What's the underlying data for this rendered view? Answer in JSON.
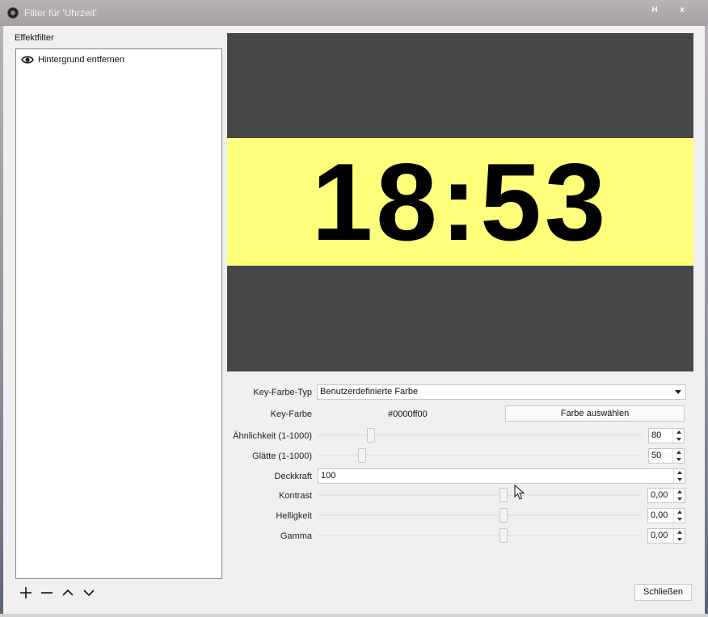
{
  "window": {
    "title": "Filter für 'Uhrzeit'",
    "help_label": "H",
    "close_label": "x"
  },
  "filters": {
    "section_label": "Effektfilter",
    "items": [
      {
        "name": "Hintergrund entfernen",
        "visible": true
      }
    ]
  },
  "preview": {
    "clock": "18:53",
    "background_color": "#474747",
    "band_color": "#feff7a"
  },
  "properties": {
    "key_color_type": {
      "label": "Key-Farbe-Typ",
      "value": "Benutzerdefinierte Farbe"
    },
    "key_color": {
      "label": "Key-Farbe",
      "value": "#0000ff00",
      "button": "Farbe auswählen"
    },
    "similarity": {
      "label": "Ähnlichkeit (1-1000)",
      "value": "80",
      "fraction": 0.08
    },
    "smoothness": {
      "label": "Glätte (1-1000)",
      "value": "50",
      "fraction": 0.05
    },
    "opacity": {
      "label": "Deckkraft",
      "value": "100"
    },
    "contrast": {
      "label": "Kontrast",
      "value": "0,00",
      "fraction": 0.5
    },
    "brightness": {
      "label": "Helligkeit",
      "value": "0,00",
      "fraction": 0.5
    },
    "gamma": {
      "label": "Gamma",
      "value": "0,00",
      "fraction": 0.5
    }
  },
  "footer": {
    "close_button": "Schließen"
  }
}
